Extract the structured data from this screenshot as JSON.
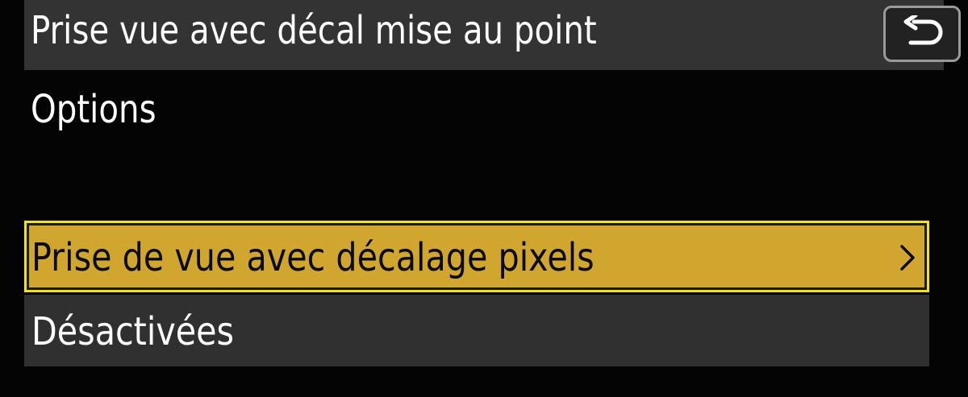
{
  "header": {
    "title": "Prise vue avec décal mise au point",
    "back_icon": "return-arrow-icon"
  },
  "section": {
    "label": "Options"
  },
  "menu": {
    "items": [
      {
        "label": "Prise de vue avec décalage pixels",
        "selected": true,
        "icon": "chevron-right-icon"
      },
      {
        "label": "Désactivées",
        "selected": false
      }
    ]
  },
  "colors": {
    "highlight_fill": "#d0a62e",
    "highlight_border": "#f2e21a",
    "bar_gray": "#333333",
    "background": "#040404"
  }
}
